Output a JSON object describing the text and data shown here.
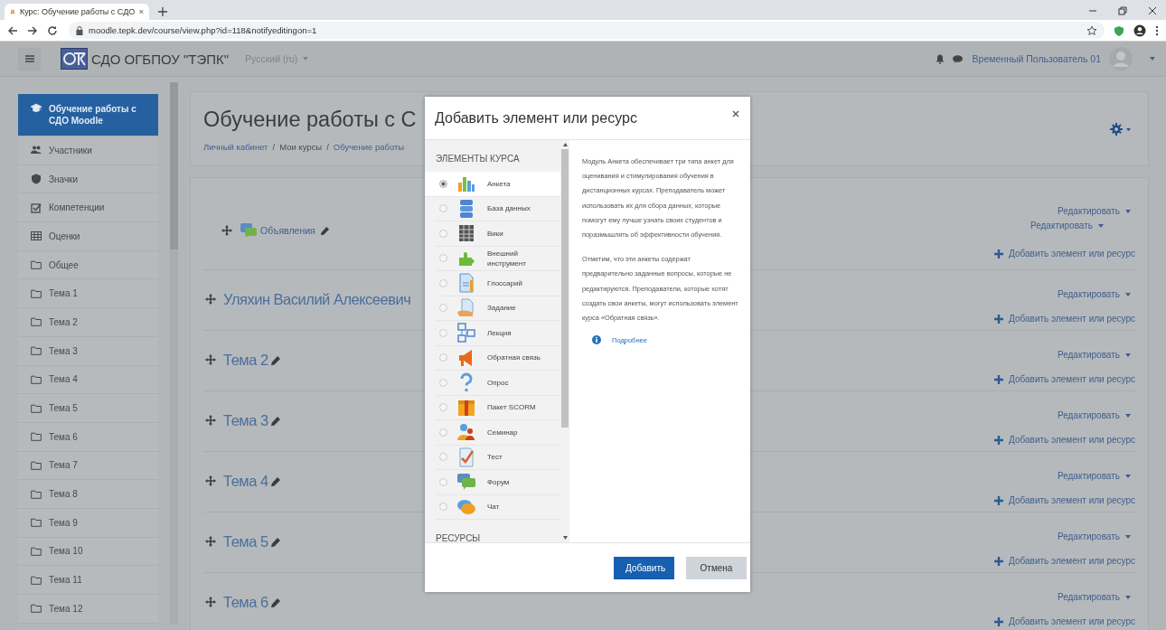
{
  "browser": {
    "tab_title": "Курс: Обучение работы с СДО",
    "url": "moodle.tepk.dev/course/view.php?id=118&notifyeditingon=1"
  },
  "navbar": {
    "site_name": "СДО ОГБПОУ \"ТЭПК\"",
    "language": "Русский (ru)",
    "user_name": "Временный Пользователь 01"
  },
  "sidebar": {
    "items": [
      {
        "label": "Обучение работы с СДО Moodle",
        "kind": "course",
        "selected": true
      },
      {
        "label": "Участники",
        "kind": "participants",
        "selected": false
      },
      {
        "label": "Значки",
        "kind": "badges",
        "selected": false
      },
      {
        "label": "Компетенции",
        "kind": "competencies",
        "selected": false
      },
      {
        "label": "Оценки",
        "kind": "grades",
        "selected": false
      },
      {
        "label": "Общее",
        "kind": "section",
        "selected": false
      },
      {
        "label": "Тема 1",
        "kind": "section",
        "selected": false
      },
      {
        "label": "Тема 2",
        "kind": "section",
        "selected": false
      },
      {
        "label": "Тема 3",
        "kind": "section",
        "selected": false
      },
      {
        "label": "Тема 4",
        "kind": "section",
        "selected": false
      },
      {
        "label": "Тема 5",
        "kind": "section",
        "selected": false
      },
      {
        "label": "Тема 6",
        "kind": "section",
        "selected": false
      },
      {
        "label": "Тема 7",
        "kind": "section",
        "selected": false
      },
      {
        "label": "Тема 8",
        "kind": "section",
        "selected": false
      },
      {
        "label": "Тема 9",
        "kind": "section",
        "selected": false
      },
      {
        "label": "Тема 10",
        "kind": "section",
        "selected": false
      },
      {
        "label": "Тема 11",
        "kind": "section",
        "selected": false
      },
      {
        "label": "Тема 12",
        "kind": "section",
        "selected": false
      }
    ]
  },
  "course": {
    "title": "Обучение работы с С",
    "separator": "/",
    "breadcrumb": [
      {
        "label": "Личный кабинет",
        "kind": "link"
      },
      {
        "label": "Мои курсы",
        "kind": "text"
      },
      {
        "label": "Обучение работы",
        "kind": "link"
      }
    ]
  },
  "sections": [
    {
      "edit_label": "Редактировать",
      "activities": [
        {
          "name": "Объявления",
          "edit_label": "Редактировать"
        }
      ],
      "add_label": "Добавить элемент или ресурс"
    },
    {
      "title": "Уляхин Василий Алексеевич",
      "show_edit_icon": false,
      "edit_label": "Редактировать",
      "add_label": "Добавить элемент или ресурс"
    },
    {
      "title": "Тема 2",
      "show_edit_icon": true,
      "edit_label": "Редактировать",
      "add_label": "Добавить элемент или ресурс"
    },
    {
      "title": "Тема 3",
      "show_edit_icon": true,
      "edit_label": "Редактировать",
      "add_label": "Добавить элемент или ресурс"
    },
    {
      "title": "Тема 4",
      "show_edit_icon": true,
      "edit_label": "Редактировать",
      "add_label": "Добавить элемент или ресурс"
    },
    {
      "title": "Тема 5",
      "show_edit_icon": true,
      "edit_label": "Редактировать",
      "add_label": "Добавить элемент или ресурс"
    },
    {
      "title": "Тема 6",
      "show_edit_icon": true,
      "edit_label": "Редактировать",
      "add_label": "Добавить элемент или ресурс"
    }
  ],
  "modal": {
    "title": "Добавить элемент или ресурс",
    "activities_heading": "ЭЛЕМЕНТЫ КУРСА",
    "activities": [
      {
        "label": "Анкета",
        "selected": true
      },
      {
        "label": "База данных",
        "selected": false
      },
      {
        "label": "Вики",
        "selected": false
      },
      {
        "label": "Внешний инструмент",
        "selected": false
      },
      {
        "label": "Глоссарий",
        "selected": false
      },
      {
        "label": "Задание",
        "selected": false
      },
      {
        "label": "Лекция",
        "selected": false
      },
      {
        "label": "Обратная связь",
        "selected": false
      },
      {
        "label": "Опрос",
        "selected": false
      },
      {
        "label": "Пакет SCORM",
        "selected": false
      },
      {
        "label": "Семинар",
        "selected": false
      },
      {
        "label": "Тест",
        "selected": false
      },
      {
        "label": "Форум",
        "selected": false
      },
      {
        "label": "Чат",
        "selected": false
      }
    ],
    "resources_heading": "РЕСУРСЫ",
    "description": [
      "Модуль Анкета обеспечивает три типа анкет для оценивания и стимулирования обучения в дистанционных курсах. Преподаватель может использовать их для сбора данных, которые помогут ему лучше узнать своих студентов и поразмышлять об эффективности обучения.",
      "Отметим, что эти анкеты содержат предварительно заданные вопросы, которые не редактируются. Преподаватели, которые хотят создать свои анкеты, могут использовать элемент курса «Обратная связь»."
    ],
    "more_link": "Подробнее",
    "buttons": [
      {
        "label": "Добавить",
        "kind": "primary"
      },
      {
        "label": "Отмена",
        "kind": "secondary"
      }
    ]
  }
}
